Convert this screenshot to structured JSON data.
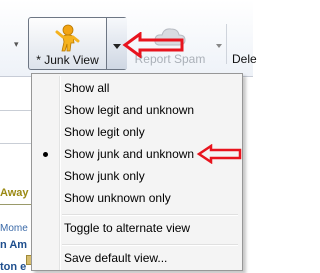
{
  "toolbar": {
    "junk_view_label": "* Junk View",
    "report_spam_label": "Report Spam",
    "delete_label": "Dele"
  },
  "background": {
    "away_text": "Away",
    "mome_text": "Mome",
    "nam_text": "n Am",
    "nam2_text": "ton e"
  },
  "menu": {
    "items": [
      {
        "label": "Show all",
        "checked": false
      },
      {
        "label": "Show legit and unknown",
        "checked": false
      },
      {
        "label": "Show legit only",
        "checked": false
      },
      {
        "label": "Show junk and unknown",
        "checked": true
      },
      {
        "label": "Show junk only",
        "checked": false
      },
      {
        "label": "Show unknown only",
        "checked": false
      },
      {
        "label": "Toggle to alternate view",
        "checked": false
      },
      {
        "label": "Save default view...",
        "checked": false
      }
    ]
  },
  "colors": {
    "annotation_red": "#e8141e",
    "menu_background": "#f4f4f4",
    "disabled_text": "#aab0b8"
  },
  "icons": {
    "junk_view": "junk-person-icon",
    "report_spam": "cloud-icon"
  }
}
